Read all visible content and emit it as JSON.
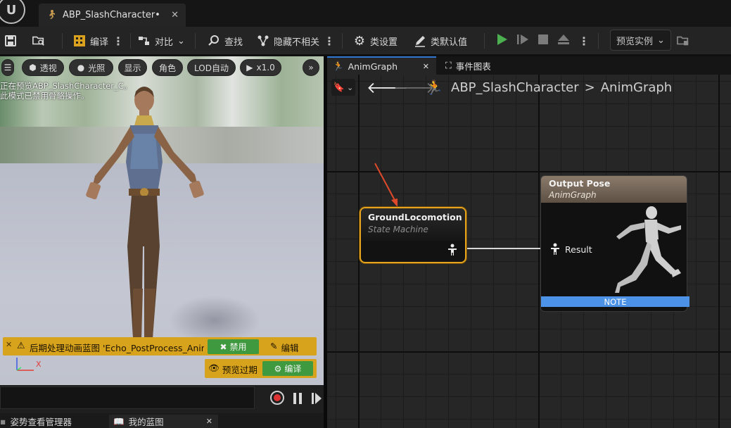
{
  "titlebar": {
    "logo_label": "U",
    "doc_tab_label": "ABP_SlashCharacter•",
    "doc_tab_close": "✕"
  },
  "toolbar": {
    "compile_label": "编译",
    "diff_label": "对比",
    "find_label": "查找",
    "hide_unrelated_label": "隐藏不相关",
    "class_settings_label": "类设置",
    "class_defaults_label": "类默认值",
    "preview_instance_label": "预览实例"
  },
  "viewport": {
    "menu_icon": "hamburger-icon",
    "perspective_label": "透视",
    "lighting_label": "光照",
    "show_label": "显示",
    "character_label": "角色",
    "lod_label": "LOD自动",
    "speed_label": "x1.0",
    "preview_note_line1": "正在预览ABP_SlashCharacter_C。",
    "preview_note_line2": "此模式已禁用骨骼操作。",
    "warning_text": "后期处理动画蓝图 'Echo_PostProcess_Anim",
    "disable_label": "禁用",
    "edit_label": "编辑",
    "preview_expired_label": "预览过期",
    "compile_label": "编译",
    "axis_x": "X"
  },
  "bottom_tabs": {
    "pose_watch_label": "姿势查看管理器",
    "my_blueprint_label": "我的蓝图",
    "close_label": "✕"
  },
  "graph_tabs": {
    "animgraph_label": "AnimGraph",
    "animgraph_close": "✕",
    "event_graph_label": "事件图表"
  },
  "breadcrumb": {
    "blueprint": "ABP_SlashCharacter",
    "separator": ">",
    "graph": "AnimGraph"
  },
  "nodes": {
    "state_machine": {
      "title": "GroundLocomotion",
      "subtitle": "State Machine"
    },
    "output_pose": {
      "title": "Output Pose",
      "subtitle": "AnimGraph",
      "pin_label": "Result",
      "note_label": "NOTE"
    }
  },
  "colors": {
    "selected_node_outline": "#e5a41b",
    "note_bar": "#4c93e8",
    "play_button": "#4caf50",
    "warning_banner": "#d8a31c",
    "green_button": "#3f9a3f"
  }
}
